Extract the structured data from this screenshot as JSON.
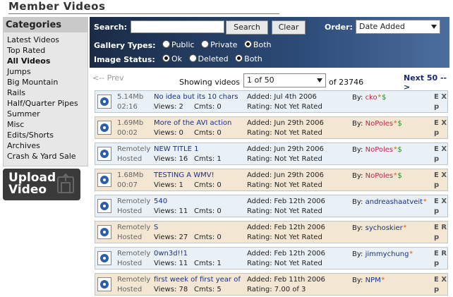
{
  "page": {
    "title": "Member Videos"
  },
  "sidebar": {
    "heading": "Categories",
    "items": [
      "Latest Videos",
      "Top Rated",
      "All Videos",
      "Jumps",
      "Big Mountain",
      "Rails",
      "Half/Quarter Pipes",
      "Summer",
      "Misc",
      "Edits/Shorts",
      "Archives",
      "Crash & Yard Sale"
    ],
    "active": "All Videos"
  },
  "upload": {
    "line1": "Upload",
    "line2": "Video"
  },
  "search": {
    "label": "Search:",
    "value": "",
    "search_button": "Search",
    "clear_button": "Clear",
    "order_label": "Order:",
    "order_value": "Date Added",
    "gallery_label": "Gallery Types:",
    "gallery_options": [
      "Public",
      "Private",
      "Both"
    ],
    "gallery_selected": "Both",
    "status_label": "Image Status:",
    "status_options": [
      "Ok",
      "Deleted",
      "Both"
    ],
    "status_selected": "Both"
  },
  "pagination": {
    "prev": "<-- Prev",
    "showing": "Showing videos",
    "page_value": "1 of 50",
    "total": "of 23746",
    "next": "Next 50 -->"
  },
  "videos": [
    {
      "size": "5.14Mb",
      "duration": "02:16",
      "title": "No idea but its 10 chars",
      "views": "Views: 2",
      "comments": "Cmts: 0",
      "added": "Added: Jul 4th 2006",
      "rating": "Rating: Not Yet Rated",
      "by": "By:",
      "user": "cko",
      "badge": "$",
      "ex": "E X",
      "p": "p"
    },
    {
      "size": "1.69Mb",
      "duration": "00:02",
      "title": "More of the AVI action",
      "views": "Views: 0",
      "comments": "Cmts: 0",
      "added": "Added: Jun 29th 2006",
      "rating": "Rating: Not Yet Rated",
      "by": "By:",
      "user": "NoPoles",
      "badge": "$",
      "ex": "E X",
      "p": "p"
    },
    {
      "size": "Remotely",
      "duration": "Hosted",
      "title": "NEW TITLE 1",
      "views": "Views: 16",
      "comments": "Cmts: 1",
      "added": "Added: Jun 29th 2006",
      "rating": "Rating: Not Yet Rated",
      "by": "By:",
      "user": "NoPoles",
      "badge": "$",
      "ex": "E X",
      "p": "p"
    },
    {
      "size": "1.68Mb",
      "duration": "00:07",
      "title": "TESTING A WMV!",
      "views": "Views: 1",
      "comments": "Cmts: 0",
      "added": "Added: Jun 29th 2006",
      "rating": "Rating: Not Yet Rated",
      "by": "By:",
      "user": "NoPoles",
      "badge": "$",
      "ex": "E X",
      "p": "p"
    },
    {
      "size": "Remotely",
      "duration": "Hosted",
      "title": "540",
      "views": "Views: 11",
      "comments": "Cmts: 0",
      "added": "Added: Feb 12th 2006",
      "rating": "Rating: Not Yet Rated",
      "by": "By:",
      "user": "andreashaatveit",
      "badge": "",
      "ex": "E X",
      "p": "p"
    },
    {
      "size": "Remotely",
      "duration": "Hosted",
      "title": "S",
      "views": "Views: 27",
      "comments": "Cmts: 0",
      "added": "Added: Feb 12th 2006",
      "rating": "Rating: Not Yet Rated",
      "by": "By:",
      "user": "sychoskier",
      "badge": "",
      "ex": "E R",
      "p": "p"
    },
    {
      "size": "Remotely",
      "duration": "Hosted",
      "title": "0wn3d!!1",
      "views": "Views: 11",
      "comments": "Cmts: 1",
      "added": "Added: Feb 12th 2006",
      "rating": "Rating: Not Yet Rated",
      "by": "By:",
      "user": "jimmychung",
      "badge": "",
      "ex": "E R",
      "p": "p"
    },
    {
      "size": "Remotely",
      "duration": "Hosted",
      "title": "first week of first year of",
      "views": "Views: 78",
      "comments": "Cmts: 5",
      "added": "Added: Feb 11th 2006",
      "rating": "Rating: 7.00 of 3",
      "by": "By:",
      "user": "NPM",
      "badge": "",
      "ex": "E X",
      "p": "p"
    }
  ]
}
